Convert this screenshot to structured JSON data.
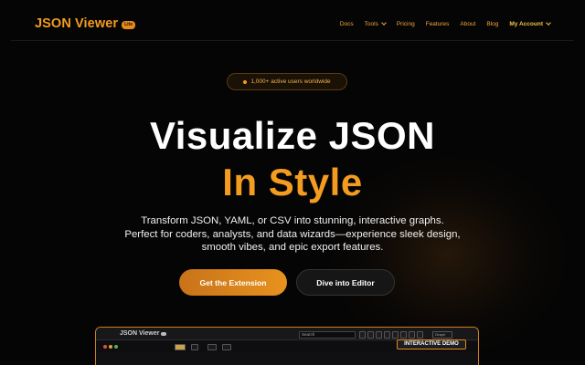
{
  "nav": {
    "brand": "JSON Viewer",
    "brand_badge": "Lite",
    "links": [
      {
        "label": "Docs"
      },
      {
        "label": "Tools"
      },
      {
        "label": "Pricing"
      },
      {
        "label": "Features"
      },
      {
        "label": "About"
      },
      {
        "label": "Blog"
      }
    ],
    "account_label": "My Account"
  },
  "hero": {
    "badge": "1,000+ active users worldwide",
    "title": "Visualize JSON",
    "title_accent": "In Style",
    "description": "Transform JSON, YAML, or CSV into stunning, interactive graphs. Perfect for coders, analysts, and data wizards—experience sleek design, smooth vibes, and epic export features.",
    "primary_button": "Get the Extension",
    "secondary_button": "Dive into Editor"
  },
  "demo": {
    "brand": "JSON Viewer",
    "search_placeholder": "Search",
    "select_value": "Graph",
    "tag": "INTERACTIVE DEMO"
  },
  "colors": {
    "accent": "#f39c1f",
    "background": "#050505",
    "text": "#ffffff"
  },
  "icons": [
    "chevron-down-icon",
    "status-dot-icon"
  ]
}
